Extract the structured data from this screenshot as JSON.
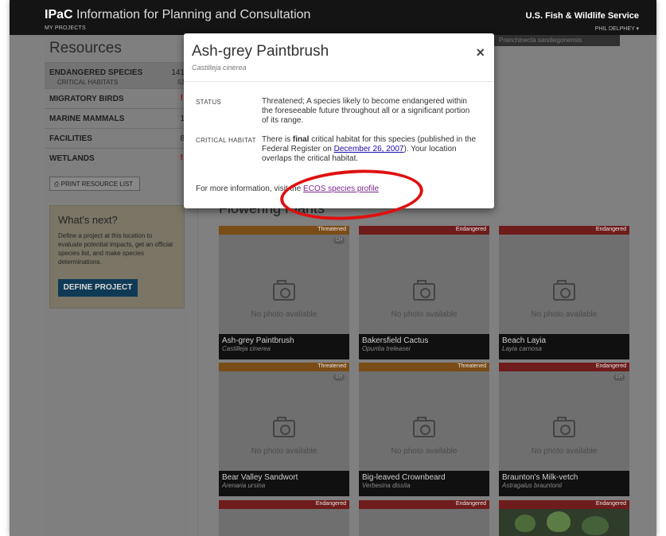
{
  "header": {
    "brand_bold": "IPaC",
    "brand_rest": " Information for Planning and Consultation",
    "my_projects": "MY PROJECTS",
    "agency": "U.S. Fish & Wildlife Service",
    "user": "PHIL DELPHEY ▾"
  },
  "sidebar": {
    "title": "Resources",
    "items": [
      {
        "label": "ENDANGERED SPECIES",
        "count": "141",
        "sub_label": "CRITICAL HABITATS",
        "sub_count": "53"
      },
      {
        "label": "MIGRATORY BIRDS",
        "warn": "!"
      },
      {
        "label": "MARINE MAMMALS",
        "count": "1"
      },
      {
        "label": "FACILITIES",
        "count": "8"
      },
      {
        "label": "WETLANDS",
        "warn": "!"
      }
    ],
    "print_label": "⎙ PRINT RESOURCE LIST"
  },
  "next": {
    "title": "What's next?",
    "text": "Define a project at this location to evaluate potential impacts, get an official species list, and make species determinations.",
    "button": "DEFINE PROJECT"
  },
  "main": {
    "map_text": "Pranchinecta sandiegonensis",
    "section_title": "Flowering Plants",
    "no_photo": "No photo available",
    "ch_badge": "CH",
    "cards": [
      {
        "status": "Threatened",
        "name": "Ash-grey Paintbrush",
        "sci": "Castilleja cinerea",
        "ch": true
      },
      {
        "status": "Endangered",
        "name": "Bakersfield Cactus",
        "sci": "Opuntia treleasei",
        "ch": false
      },
      {
        "status": "Endangered",
        "name": "Beach Layia",
        "sci": "Layia carnosa",
        "ch": false
      },
      {
        "status": "Threatened",
        "name": "Bear Valley Sandwort",
        "sci": "Arenaria ursina",
        "ch": true
      },
      {
        "status": "Threatened",
        "name": "Big-leaved Crownbeard",
        "sci": "Verbesina dissita",
        "ch": false
      },
      {
        "status": "Endangered",
        "name": "Braunton's Milk-vetch",
        "sci": "Astragalus brauntonii",
        "ch": true
      },
      {
        "status": "Endangered"
      },
      {
        "status": "Endangered"
      },
      {
        "status": "Endangered"
      }
    ]
  },
  "modal": {
    "title": "Ash-grey Paintbrush",
    "sci": "Castilleja cinerea",
    "close": "×",
    "status_label": "STATUS",
    "status_text": "Threatened; A species likely to become endangered within the foreseeable future throughout all or a significant portion of its range.",
    "ch_label": "CRITICAL HABITAT",
    "ch_pre": "There is ",
    "ch_bold": "final",
    "ch_mid": " critical habitat for this species (published in the Federal Register on ",
    "ch_link": "December 26, 2007",
    "ch_post": "). Your location overlaps the critical habitat.",
    "more_pre": "For more information, visit the ",
    "more_link": "ECOS species profile"
  },
  "colors": {
    "threatened": "#e08a2c",
    "endangered": "#d23b3b",
    "annotation": "#e01010",
    "primary_button": "#1a6496"
  }
}
